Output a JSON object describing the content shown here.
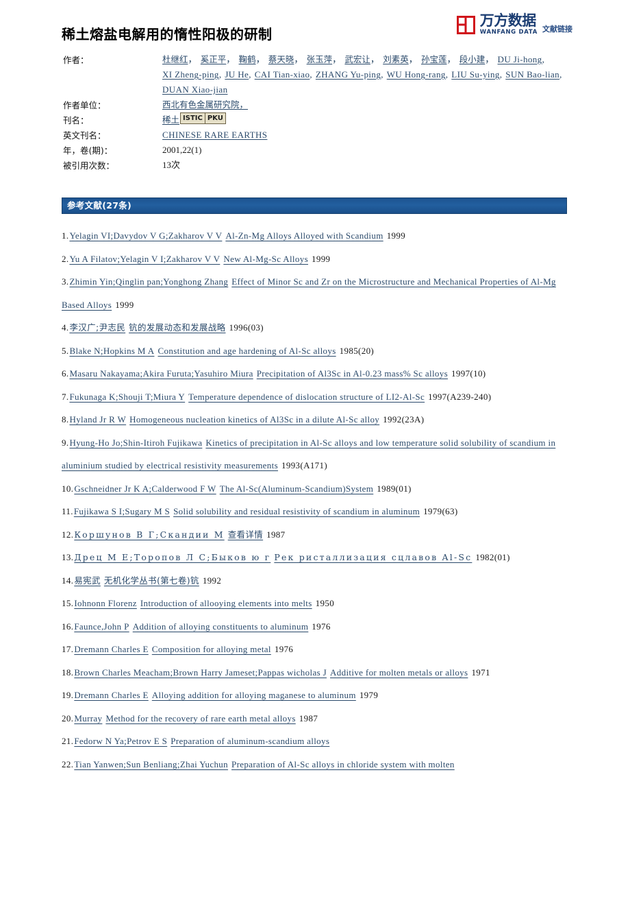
{
  "logo": {
    "cn_name": "万方数据",
    "en_name": "WANFANG DATA",
    "link_label": "文献链接",
    "mark_color": "#d0141b",
    "text_color": "#1b3d72"
  },
  "document": {
    "title": "稀土熔盐电解用的惰性阳极的研制"
  },
  "meta": {
    "labels": {
      "authors": "作者：",
      "affiliation": "作者单位：",
      "journal": "刊名：",
      "journal_en": "英文刊名：",
      "year_volume": "年，卷(期)：",
      "cited": "被引用次数："
    },
    "authors_cn": [
      "杜继红",
      "奚正平",
      "鞠鹤",
      "蔡天晓",
      "张玉萍",
      "武宏让",
      "刘素英",
      "孙宝莲",
      "段小建"
    ],
    "authors_en": [
      "DU Ji-hong",
      "XI Zheng-ping",
      "JU He",
      "CAI Tian-xiao",
      "ZHANG Yu-ping",
      "WU Hong-rang",
      "LIU Su-ying",
      "SUN Bao-lian",
      "DUAN Xiao-jian"
    ],
    "affiliation": "西北有色金属研究院，",
    "journal": "稀土",
    "journal_badges": [
      "ISTIC",
      "PKU"
    ],
    "journal_en": "CHINESE RARE EARTHS",
    "year_volume": "2001,22(1)",
    "cited": "13次"
  },
  "references": {
    "header": "参考文献(27条)",
    "accent_color": "#1d5390",
    "items": [
      {
        "num": "1.",
        "authors": "Yelagin VI;Davydov V G;Zakharov V V",
        "title": "Al-Zn-Mg Alloys Alloyed with Scandium",
        "year": "1999"
      },
      {
        "num": "2.",
        "authors": "Yu A Filatov;Yelagin V I;Zakharov V V",
        "title": "New Al-Mg-Sc Alloys",
        "year": "1999"
      },
      {
        "num": "3.",
        "authors": "Zhimin Yin;Qinglin pan;Yonghong Zhang",
        "title": "Effect of Minor Sc and Zr on the Microstructure and Mechanical Properties of Al-Mg Based Alloys",
        "year": "1999"
      },
      {
        "num": "4.",
        "authors": "李汉广;尹志民",
        "title": "钪的发展动态和发展战略",
        "year": "1996(03)",
        "script": "cn"
      },
      {
        "num": "5.",
        "authors": "Blake N;Hopkins M A",
        "title": "Constitution and age hardening of Al-Sc alloys",
        "year": "1985(20)"
      },
      {
        "num": "6.",
        "authors": "Masaru Nakayama;Akira Furuta;Yasuhiro Miura",
        "title": "Precipitation of Al3Sc in Al-0.23 mass% Sc alloys",
        "year": "1997(10)"
      },
      {
        "num": "7.",
        "authors": "Fukunaga K;Shouji T;Miura Y",
        "title": "Temperature dependence of dislocation structure of LI2-Al-Sc",
        "year": "1997(A239-240)"
      },
      {
        "num": "8.",
        "authors": "Hyland Jr R W",
        "title": "Homogeneous nucleation kinetics of Al3Sc in a dilute Al-Sc alloy",
        "year": "1992(23A)"
      },
      {
        "num": "9.",
        "authors": "Hyung-Ho Jo;Shin-Itiroh Fujikawa",
        "title": "Kinetics of precipitation in Al-Sc alloys and low temperature solid solubility of scandium in aluminium studied by electrical resistivity measurements",
        "year": "1993(A171)"
      },
      {
        "num": "10.",
        "authors": "Gschneidner Jr K A;Calderwood F W",
        "title": "The Al-Sc(Aluminum-Scandium)System",
        "year": "1989(01)"
      },
      {
        "num": "11.",
        "authors": "Fujikawa S I;Sugary M S",
        "title": "Solid solubility and residual resistivity of scandium in aluminum",
        "year": "1979(63)"
      },
      {
        "num": "12.",
        "authors": "Коршунов В Г;Скандии М",
        "title": "查看详情",
        "year": "1987",
        "script": "cyr-cn"
      },
      {
        "num": "13.",
        "authors": "Дрец М Е;Торопов Л С;Быков ю г",
        "title": "Рек ристаллизация сцлавов  Al-Sc",
        "year": "1982(01)",
        "script": "cyr"
      },
      {
        "num": "14.",
        "authors": "易宪武",
        "title": "无机化学丛书(第七卷)钪",
        "year": "1992",
        "script": "cn"
      },
      {
        "num": "15.",
        "authors": "Iohnonn Florenz",
        "title": "Introduction of allooying elements into melts",
        "year": "1950"
      },
      {
        "num": "16.",
        "authors": "Faunce,John P",
        "title": "Addition of alloying constituents to aluminum",
        "year": "1976"
      },
      {
        "num": "17.",
        "authors": "Dremann Charles E",
        "title": "Composition for alloying metal",
        "year": "1976"
      },
      {
        "num": "18.",
        "authors": "Brown Charles Meacham;Brown Harry Jameset;Pappas wicholas J",
        "title": "Additive for molten metals or alloys",
        "year": "1971"
      },
      {
        "num": "19.",
        "authors": "Dremann Charles E",
        "title": "Alloying addition for alloying maganese to aluminum",
        "year": "1979"
      },
      {
        "num": "20.",
        "authors": "Murray",
        "title": "Method for the recovery of rare earth metal alloys",
        "year": "1987"
      },
      {
        "num": "21.",
        "authors": "Fedorw N Ya;Petrov E S",
        "title": "Preparation of aluminum-scandium alloys",
        "year": ""
      },
      {
        "num": "22.",
        "authors": "Tian Yanwen;Sun Benliang;Zhai Yuchun",
        "title": "Preparation of Al-Sc alloys in chloride system with molten",
        "year": ""
      }
    ]
  }
}
